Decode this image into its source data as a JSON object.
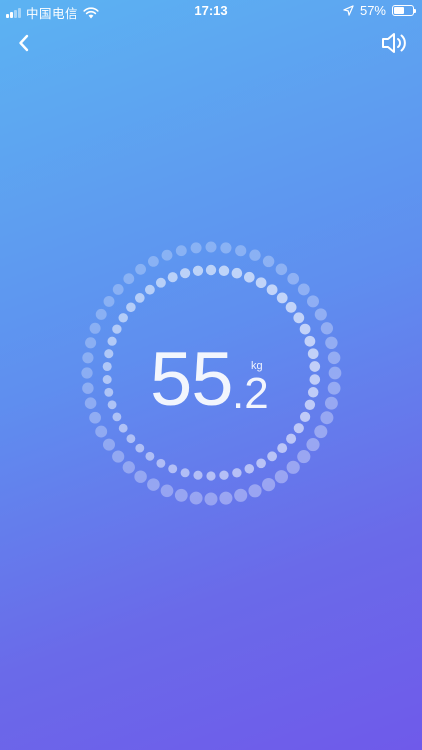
{
  "status_bar": {
    "carrier": "中国电信",
    "time": "17:13",
    "battery_percent": "57%",
    "battery_level": 0.57
  },
  "nav": {
    "back_icon": "chevron-left-icon",
    "sound_icon": "speaker-icon"
  },
  "weight": {
    "integer": "55",
    "decimal": ".2",
    "unit": "kg"
  },
  "theme": {
    "gradient_top": "#5cb3f2",
    "gradient_bottom": "#6f5aea",
    "accent": "#ffffff"
  }
}
